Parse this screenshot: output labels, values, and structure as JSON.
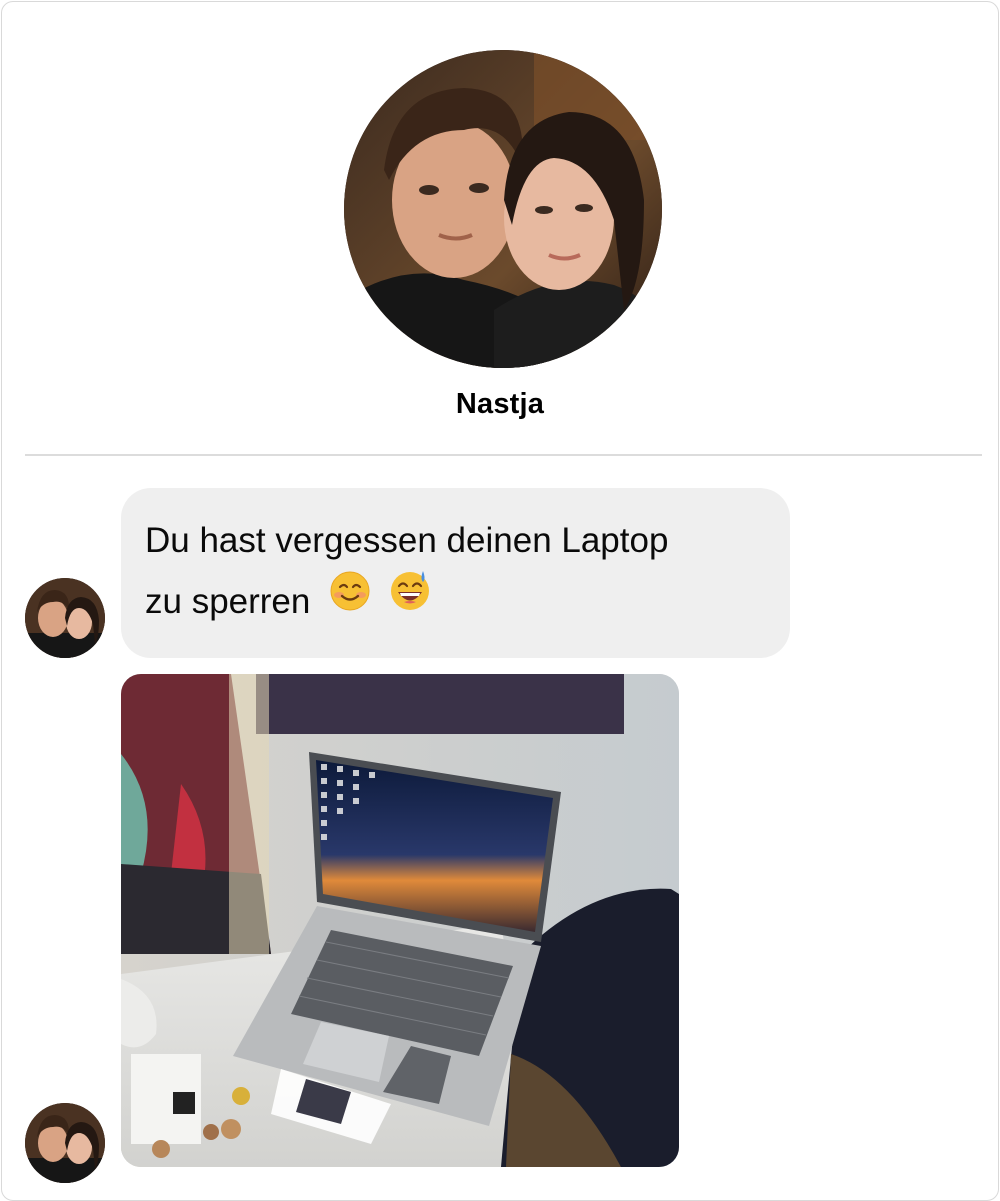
{
  "profile": {
    "name": "Nastja",
    "photo_icon": "couple-selfie-photo"
  },
  "messages": [
    {
      "sender": "Nastja",
      "text_line1": "Du hast vergessen deinen Laptop",
      "text_line2": "zu sperren",
      "emojis": [
        "smiling-face-icon",
        "grinning-sweat-face-icon"
      ]
    },
    {
      "sender": "Nastja",
      "image": "photo-of-unlocked-laptop-on-desk"
    }
  ],
  "colors": {
    "bubble_bg": "#efefef",
    "divider": "#dcdcdc",
    "emoji_yellow": "#f7c034"
  }
}
